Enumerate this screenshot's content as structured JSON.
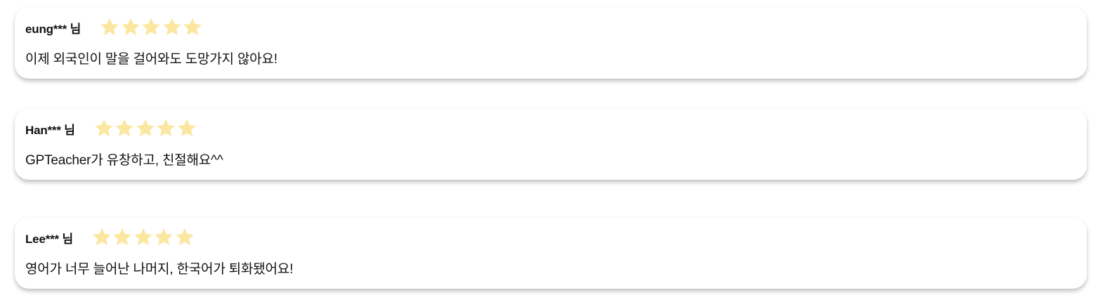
{
  "reviews": [
    {
      "name": "eung*** 님",
      "rating": 5,
      "text": "이제 외국인이 말을 걸어와도 도망가지 않아요!"
    },
    {
      "name": "Han*** 님",
      "rating": 5,
      "text": "GPTeacher가 유창하고, 친절해요^^"
    },
    {
      "name": "Lee*** 님",
      "rating": 5,
      "text": "영어가 너무 늘어난 나머지, 한국어가 퇴화됐어요!"
    }
  ],
  "colors": {
    "star": "#FBE7A0",
    "card_background": "#FFFFFF",
    "text": "#111111"
  },
  "icons": {
    "rating": "star-icon"
  }
}
